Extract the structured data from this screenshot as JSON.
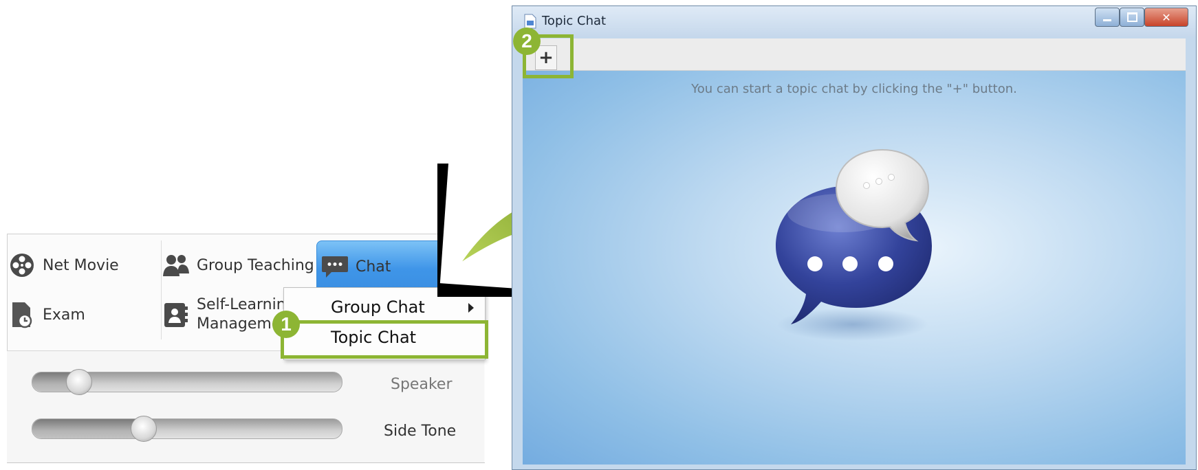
{
  "toolbar": {
    "net_movie": "Net Movie",
    "group_teaching": "Group Teaching",
    "chat": "Chat",
    "exam": "Exam",
    "self_learning_line1": "Self-Learning",
    "self_learning_line2": "Management"
  },
  "chat_menu": {
    "group_chat": "Group Chat",
    "topic_chat": "Topic Chat"
  },
  "audio": {
    "speaker_label": "Speaker",
    "speaker_level": 0.15,
    "side_tone_label": "Side Tone",
    "side_tone_level": 0.36
  },
  "steps": {
    "step1": "1",
    "step2": "2"
  },
  "window": {
    "title": "Topic Chat",
    "add_button": "+",
    "hint": "You can start a topic chat by clicking the \"+\" button."
  },
  "colors": {
    "highlight": "#8db534",
    "chat_button": "#3f95e8",
    "bubble_blue": "#2f3f9a"
  }
}
